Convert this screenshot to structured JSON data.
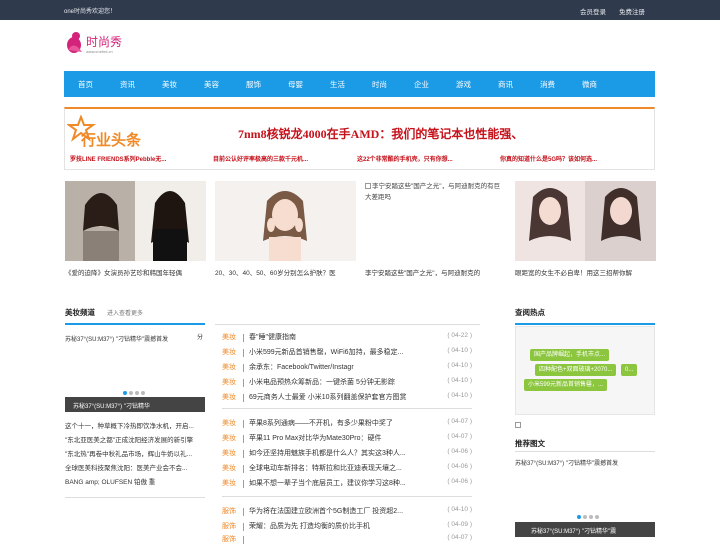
{
  "topbar": {
    "welcome": "one时尚秀欢迎您！",
    "login": "会员登录",
    "register": "免费注册"
  },
  "logo": {
    "text": "时尚秀",
    "url_text": "www.onefed.cn"
  },
  "nav": [
    "首页",
    "资讯",
    "美妆",
    "美容",
    "服饰",
    "母婴",
    "生活",
    "时尚",
    "企业",
    "游戏",
    "商讯",
    "消费",
    "微商"
  ],
  "banner": {
    "logo_text": "行业头条",
    "headline": "7nm8核锐龙4000在手AMD：我们的笔记本也性能强、",
    "subs": [
      "罗技LINE FRIENDS系列Pebble无...",
      "目前公认好评率极高的三款千元机...",
      "这22个非常酷的手机壳，只有你想...",
      "你真的知道什么是5G吗？该如何选..."
    ]
  },
  "photos": {
    "captions": [
      "《爱的迫降》女演员孙艺珍和韩国年轻偶",
      "20、30、40、50、60岁分别怎么护肤？医",
      "李宁安踏这些\"国产之光\"，与阿迪耐克的",
      "眼距宽的女生不必自卑！用这三招帮你解"
    ],
    "broken_alt": "李宁安踏这些\"国产之光\"，与阿迪耐克的有巨大差距吗"
  },
  "beauty": {
    "title": "美妆频道",
    "more": "进入查看更多",
    "slide_text": "苏秘37°(SU:M37°) \"刁钻精华\"震撼首发",
    "slide_side": "分",
    "slide_caption": "苏秘37°(SU:M37°) \"刁钻精华",
    "left_list": [
      "这个十一，种草概下冷热即饮净水机，开启...",
      "\"东北亚医美之都\"正成沈阳经济发展的新引擎",
      "\"东北热\"再卷中秋礼品市场，辉山牛奶以礼...",
      "全球医美科技聚焦沈阳：医美产业会不会...",
      "BANG amp; OLUFSEN 铂傲 重"
    ]
  },
  "news": [
    {
      "cat": "美妆",
      "title": "春\"睡\"健康指南",
      "date": "( 04-22 )"
    },
    {
      "cat": "美妆",
      "title": "小米599元新品首销售罄，WiFi6加持，最多稳定...",
      "date": "( 04-10 )"
    },
    {
      "cat": "美妆",
      "title": "余承东：Facebook/Twitter/Instagr",
      "date": "( 04-10 )"
    },
    {
      "cat": "美妆",
      "title": "小米电品预热众筹新品：一键杀菌 5分钟无影踪",
      "date": "( 04-10 )"
    },
    {
      "cat": "美妆",
      "title": "69元商务人士最爱 小米10系列翻盖保护套官方图赏",
      "date": "( 04-10 )"
    },
    {
      "cat": "美妆",
      "title": "苹果8系列通病——不开机，有多少果粉中奖了",
      "date": "( 04-07 )"
    },
    {
      "cat": "美妆",
      "title": "苹果11 Pro Max对比华为Mate30Pro：硬件",
      "date": "( 04-07 )"
    },
    {
      "cat": "美妆",
      "title": "如今还坚持用魅族手机都是什么人？其实这3种人...",
      "date": "( 04-06 )"
    },
    {
      "cat": "美妆",
      "title": "全球电动车新排名：特斯拉和比亚迪表现天壤之...",
      "date": "( 04-06 )"
    },
    {
      "cat": "美妆",
      "title": "如果不想一辈子当个底层员工，建议你学习这8种...",
      "date": "( 04-06 )"
    },
    {
      "cat": "服饰",
      "title": "华为将在法国建立欧洲首个5G制造工厂 投资超2...",
      "date": "( 04-10 )"
    },
    {
      "cat": "服饰",
      "title": "荣耀：品质为先 打造均衡的质价比手机",
      "date": "( 04-09 )"
    },
    {
      "cat": "服饰",
      "title": "",
      "date": "( 04-07 )"
    }
  ],
  "hot": {
    "title": "查阅热点",
    "tags": [
      "国产品牌崛起，手机市点...",
      "四种配色+双面玻璃+2070...",
      "小米599元新品首销售罄，...",
      "0..."
    ]
  },
  "recommend": {
    "title": "推荐图文",
    "slide_text": "苏秘37°(SU:M37°) \"刁钻精华\"震撼首发",
    "slide_caption": "苏秘37°(SU:M37°) \"刁钻精华\"震"
  },
  "colors": {
    "accent": "#1b9ae6",
    "orange": "#f08a28",
    "red": "#c5121b",
    "topbar": "#2f3a4c",
    "tag_green": "#8cc63f"
  }
}
